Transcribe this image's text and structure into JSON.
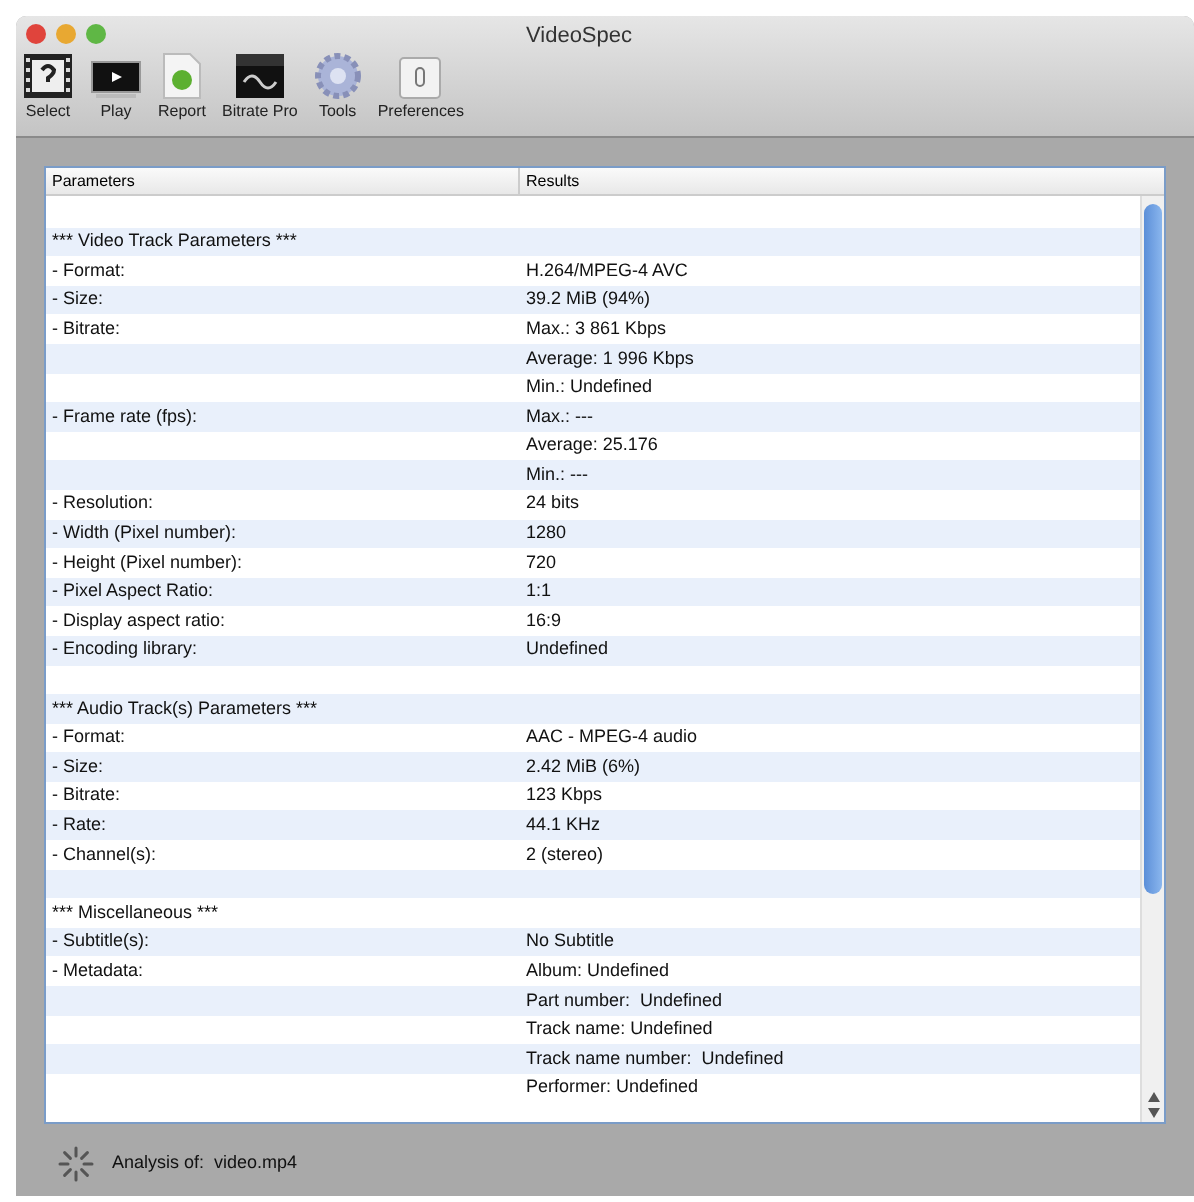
{
  "window": {
    "title": "VideoSpec"
  },
  "toolbar": [
    {
      "label": "Select",
      "kind": "select"
    },
    {
      "label": "Play",
      "kind": "play"
    },
    {
      "label": "Report",
      "kind": "report"
    },
    {
      "label": "Bitrate Pro",
      "kind": "bitrate"
    },
    {
      "label": "Tools",
      "kind": "tools"
    },
    {
      "label": "Preferences",
      "kind": "preferences"
    }
  ],
  "table": {
    "columns": [
      "Parameters",
      "Results"
    ],
    "rows": [
      {},
      {
        "parameter": "*** Video Track Parameters ***"
      },
      {
        "parameter": "- Format:",
        "result": "H.264/MPEG-4 AVC"
      },
      {
        "parameter": "- Size:",
        "result": "39.2 MiB (94%)"
      },
      {
        "parameter": "- Bitrate:",
        "result": "Max.: 3 861 Kbps"
      },
      {
        "result": "Average: 1 996 Kbps"
      },
      {
        "result": "Min.: Undefined"
      },
      {
        "parameter": "- Frame rate (fps):",
        "result": "Max.: ---"
      },
      {
        "result": "Average: 25.176"
      },
      {
        "result": "Min.: ---"
      },
      {
        "parameter": "- Resolution:",
        "result": "24 bits"
      },
      {
        "parameter": "- Width (Pixel number):",
        "result": "1280"
      },
      {
        "parameter": "- Height (Pixel number):",
        "result": "720"
      },
      {
        "parameter": "- Pixel Aspect Ratio:",
        "result": "1:1"
      },
      {
        "parameter": "- Display aspect ratio:",
        "result": "16:9"
      },
      {
        "parameter": "- Encoding library:",
        "result": "Undefined"
      },
      {},
      {
        "parameter": "*** Audio Track(s) Parameters ***"
      },
      {
        "parameter": "- Format:",
        "result": "AAC - MPEG-4 audio"
      },
      {
        "parameter": "- Size:",
        "result": "2.42 MiB (6%)"
      },
      {
        "parameter": "- Bitrate:",
        "result": "123 Kbps"
      },
      {
        "parameter": "- Rate:",
        "result": "44.1 KHz"
      },
      {
        "parameter": "- Channel(s):",
        "result": "2 (stereo)"
      },
      {},
      {
        "parameter": "*** Miscellaneous ***"
      },
      {
        "parameter": "- Subtitle(s):",
        "result": "No Subtitle"
      },
      {
        "parameter": "- Metadata:",
        "result": "Album: Undefined"
      },
      {
        "result": "Part number:  Undefined"
      },
      {
        "result": "Track name: Undefined"
      },
      {
        "result": "Track name number:  Undefined"
      },
      {
        "result": "Performer: Undefined"
      }
    ]
  },
  "status_bar": {
    "text": "Analysis of:  video.mp4"
  }
}
